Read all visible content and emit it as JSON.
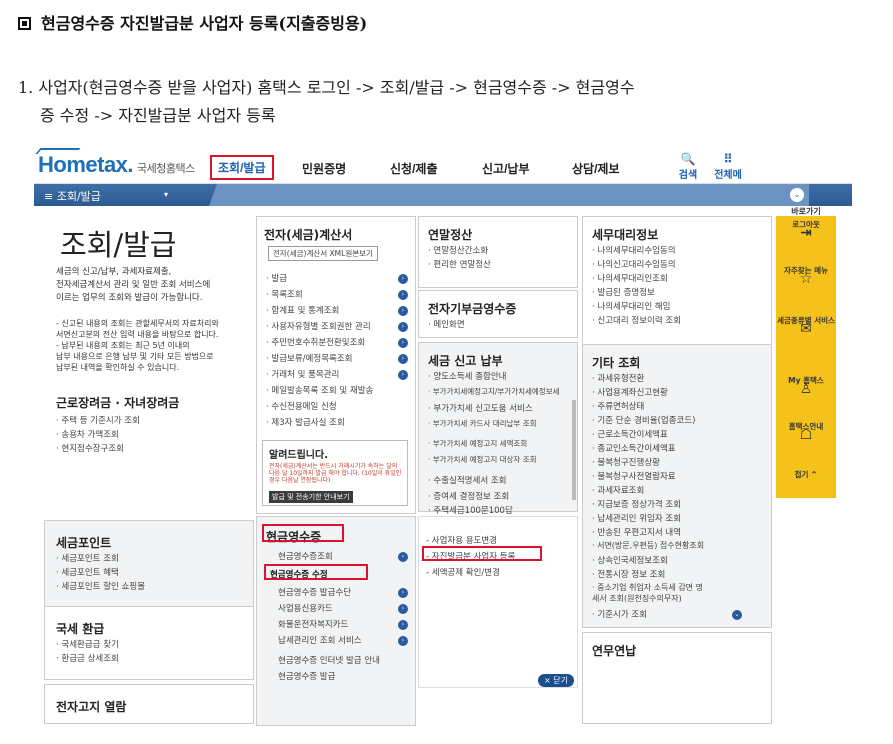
{
  "heading": "현금영수증 자진발급분 사업자 등록(지출증빙용)",
  "instruction": {
    "line1": "1. 사업자(현금영수증 받을 사업자) 홈택스 로그인 -> 조회/발급 -> 현금영수증 -> 현금영수",
    "line2": "증 수정 -> 자진발급분 사업자 등록"
  },
  "nav": {
    "logo": "Hometax.",
    "logo_sub": "국세청홈택스",
    "items": [
      "조회/발급",
      "민원증명",
      "신청/제출",
      "신고/납부",
      "상담/제보"
    ],
    "search": "검색",
    "allmenu": "전체메뉴",
    "search_icon": "search-icon",
    "menu_icon": "grid-icon"
  },
  "bar": {
    "label": "≡ 조회/발급",
    "dropdown": "▾",
    "right": "⌄"
  },
  "left": {
    "title": "조회/발급",
    "desc1": "세금의 신고/납부, 과세자료제출,",
    "desc2": "전자세금계산서 관리 및 일반 조회 서비스에",
    "desc3": "이르는 업무의 조회와 발급이 가능합니다.",
    "note1": "- 신고된 내용의 조회는 관할세무서의 자료처리와",
    "note2": "  서면신고분의 전산 입력 내용을 바탕으로 합니다.",
    "note3": "- 납부된 내용의 조회는 최근 5년 이내의",
    "note4": "  납부 내용으로 은행 납부 및 기타 모든 방법으로",
    "note5": "  납부된 내역을 확인하실 수 있습니다.",
    "sec1": "근로장려금 · 자녀장려금",
    "sec1_items": [
      "· 주택 등 기준시가 조회",
      "· 송용차 가액조회",
      "· 현지점수장구조회"
    ]
  },
  "etax": {
    "title": "전자(세금)계산서",
    "btn": "전자(세금)계산서 XML원본보기",
    "items": [
      "· 발급",
      "· 목록조회",
      "· 합계표 및 통계조회",
      "· 사용자유형별 조회권한 관리",
      "· 주민번호수취분전환및조회",
      "· 발급보류/예정목록조회",
      "· 거래처 및 품목관리",
      "· 메일발송목록 조회 및 재발송",
      "· 수신전용메일 신청",
      "· 제3자 발급사실 조회"
    ]
  },
  "notice": {
    "title": "알려드립니다.",
    "body": "전자(세금)계산서는 반드시 거래시기가 속하는 달의 다음 달 10일까지 발급 해야 합니다. (10일이 휴일인 경우 다음날 연장됩니다)",
    "btn": "발급 및 전송기한 안내보기"
  },
  "yearend": {
    "title": "연말정산",
    "items": [
      "· 연말정산간소화",
      "· 편리한 연말정산"
    ]
  },
  "ecard": {
    "title": "전자기부금영수증",
    "items": [
      "· 메인화면"
    ]
  },
  "taxreport": {
    "title": "세금 신고 납부",
    "items": [
      "· 양도소득세 종합안내",
      "· 부가가치세예정고지/부가가치세예정보세",
      "· 부가가치세 신고도움 서비스",
      "· 부가가치세 카드사 대리납부 조회",
      "· 부가가치세 예정고지 세액조회",
      "· 부가가치세 예정고지 대상자 조회",
      "· 수출실적명세서 조회",
      "· 증여세 결정정보 조회",
      "· 주택세금100문100답"
    ]
  },
  "agent": {
    "title": "세무대리정보",
    "items": [
      "· 나의세무대리수임동의",
      "· 나의신고대리수임동의",
      "· 나의세무대리인조회",
      "· 발급된 증명정보",
      "· 나의세무대리인 해임",
      "· 신고대리 정보이력 조회"
    ]
  },
  "etc": {
    "title": "기타 조회",
    "items": [
      "· 과세유형전환",
      "· 사업용계좌신고현황",
      "· 주류면허상태",
      "· 기준 단순 경비율(업종코드)",
      "· 근로소득간이세액표",
      "· 종교인소득간이세액표",
      "· 불복청구진행상황",
      "· 불복청구사전열람자료",
      "· 과세자료조회",
      "· 지급보증 정상가격 조회",
      "· 납세관리인 위임자 조회",
      "· 반송된 우편고지서 내역",
      "· 서면(방문,우편등) 접수현황조회",
      "· 상속인국세정보조회",
      "· 전통시장 정보 조회",
      "· 중소기업 취업자 소득세 감면 명",
      "  세서 조회(원천징수의무자)",
      "· 기준시가 조회"
    ]
  },
  "points": {
    "title": "세금포인트",
    "items": [
      "· 세금포인트 조회",
      "· 세금포인트 혜택",
      "· 세금포인트 할인 쇼핑몰"
    ]
  },
  "refund": {
    "title": "국세 환급",
    "items": [
      "· 국세환급금 찾기",
      "· 환급금 상세조회"
    ]
  },
  "ebill": {
    "title": "전자고지 열람"
  },
  "cash": {
    "title": "현금영수증",
    "items": [
      "현금영수증조회",
      "현금영수증 수정",
      "현금영수증 발급수단",
      "사업용신용카드",
      "화물운전자복지카드",
      "납세관리인 조회 서비스",
      "현금영수증 인터넷 발급 안내",
      "현금영수증 발급"
    ]
  },
  "cashsub": {
    "items": [
      "- 사업자용 용도변경",
      "- 자진발급분 사업자 등록",
      "- 세액공제 확인/변경"
    ],
    "close": "× 닫기"
  },
  "pension": {
    "title": "연무연납"
  },
  "side": {
    "top": "바로가기",
    "items": [
      "로그아웃",
      "자주찾는 메뉴",
      "세금종류별 서비스",
      "My 홈택스",
      "홈택스안내",
      "접기 ^"
    ]
  }
}
